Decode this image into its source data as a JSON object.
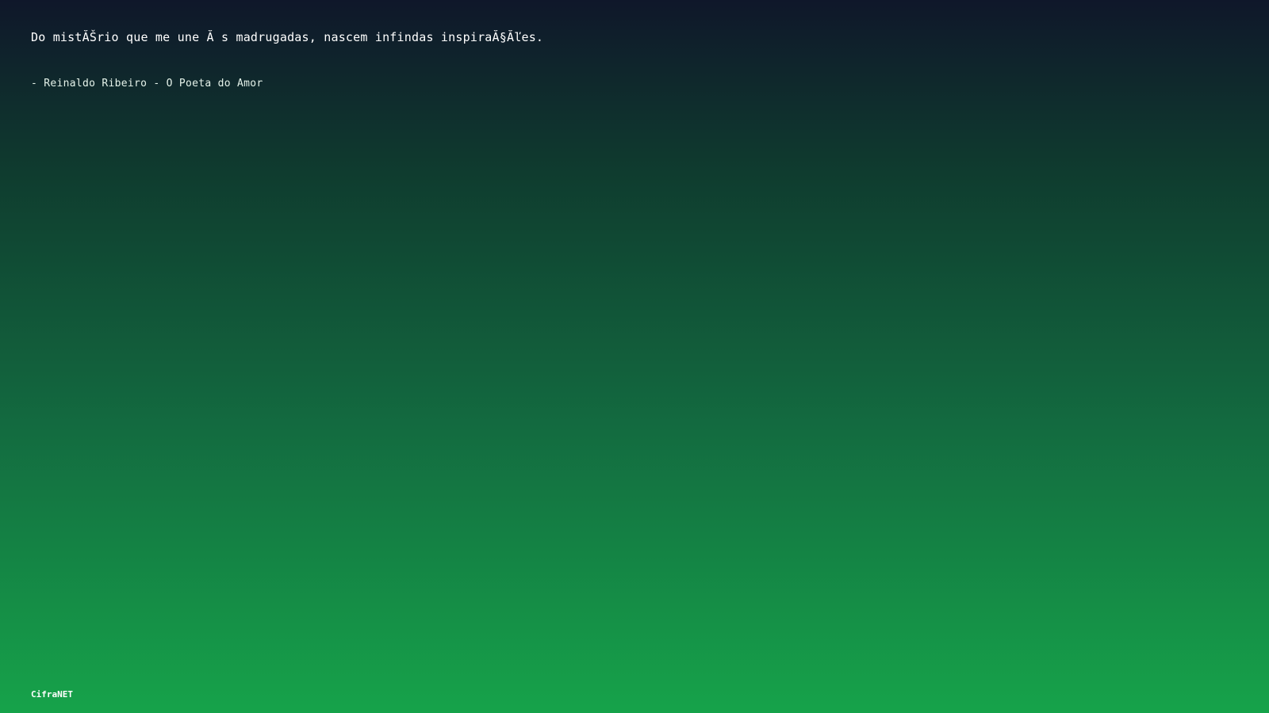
{
  "quote": {
    "text": "Do mistĂŠrio que me une Ă s madrugadas, nascem infindas inspiraĂ§Ăľes."
  },
  "attribution": {
    "text": "- Reinaldo Ribeiro - O Poeta do Amor"
  },
  "footer": {
    "brand": "CifraNET"
  },
  "colors": {
    "gradient_top": "#0f172a",
    "gradient_bottom": "#16a34a",
    "text": "#ffffff"
  }
}
